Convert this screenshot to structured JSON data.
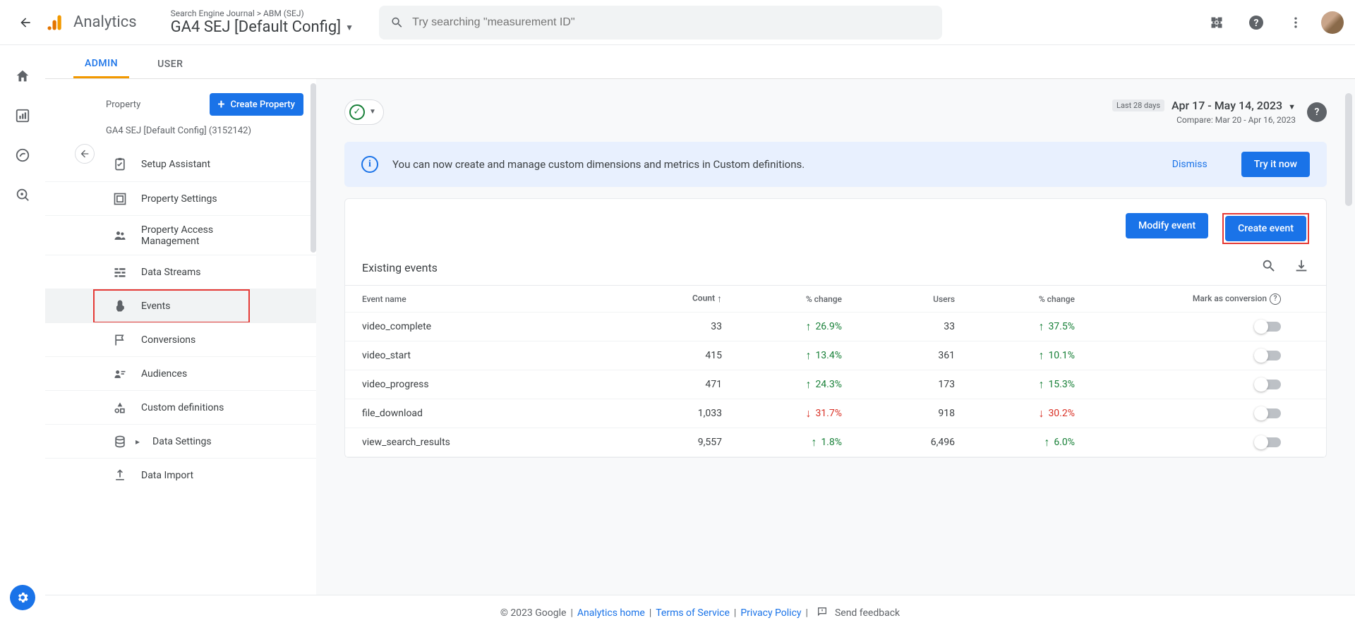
{
  "header": {
    "app_name": "Analytics",
    "breadcrumb": "Search Engine Journal > ABM (SEJ)",
    "property_label": "GA4 SEJ [Default Config]",
    "search_placeholder": "Try searching \"measurement ID\""
  },
  "tabs": {
    "admin": "ADMIN",
    "user": "USER"
  },
  "admin_nav": {
    "section_label": "Property",
    "create_property": "Create Property",
    "property_id_line": "GA4 SEJ [Default Config] (3152142)",
    "items": [
      {
        "label": "Setup Assistant",
        "icon": "clipboard-icon"
      },
      {
        "label": "Property Settings",
        "icon": "settings-box-icon"
      },
      {
        "label": "Property Access Management",
        "icon": "people-icon"
      },
      {
        "label": "Data Streams",
        "icon": "streams-icon"
      },
      {
        "label": "Events",
        "icon": "touch-icon"
      },
      {
        "label": "Conversions",
        "icon": "flag-icon"
      },
      {
        "label": "Audiences",
        "icon": "audiences-icon"
      },
      {
        "label": "Custom definitions",
        "icon": "shapes-icon"
      },
      {
        "label": "Data Settings",
        "icon": "database-icon"
      },
      {
        "label": "Data Import",
        "icon": "upload-icon"
      }
    ]
  },
  "date": {
    "badge": "Last 28 days",
    "range": "Apr 17 - May 14, 2023",
    "compare": "Compare: Mar 20 - Apr 16, 2023"
  },
  "banner": {
    "message": "You can now create and manage custom dimensions and metrics in Custom definitions.",
    "dismiss": "Dismiss",
    "try": "Try it now"
  },
  "events": {
    "modify_btn": "Modify event",
    "create_btn": "Create event",
    "title": "Existing events",
    "columns": {
      "name": "Event name",
      "count": "Count",
      "change1": "% change",
      "users": "Users",
      "change2": "% change",
      "conversion": "Mark as conversion"
    },
    "rows": [
      {
        "name": "video_complete",
        "count": "33",
        "c1": "26.9%",
        "d1": "up",
        "users": "33",
        "c2": "37.5%",
        "d2": "up"
      },
      {
        "name": "video_start",
        "count": "415",
        "c1": "13.4%",
        "d1": "up",
        "users": "361",
        "c2": "10.1%",
        "d2": "up"
      },
      {
        "name": "video_progress",
        "count": "471",
        "c1": "24.3%",
        "d1": "up",
        "users": "173",
        "c2": "15.3%",
        "d2": "up"
      },
      {
        "name": "file_download",
        "count": "1,033",
        "c1": "31.7%",
        "d1": "down",
        "users": "918",
        "c2": "30.2%",
        "d2": "down"
      },
      {
        "name": "view_search_results",
        "count": "9,557",
        "c1": "1.8%",
        "d1": "up",
        "users": "6,496",
        "c2": "6.0%",
        "d2": "up"
      }
    ]
  },
  "footer": {
    "copyright": "© 2023 Google",
    "links": {
      "home": "Analytics home",
      "tos": "Terms of Service",
      "privacy": "Privacy Policy"
    },
    "feedback": "Send feedback"
  }
}
